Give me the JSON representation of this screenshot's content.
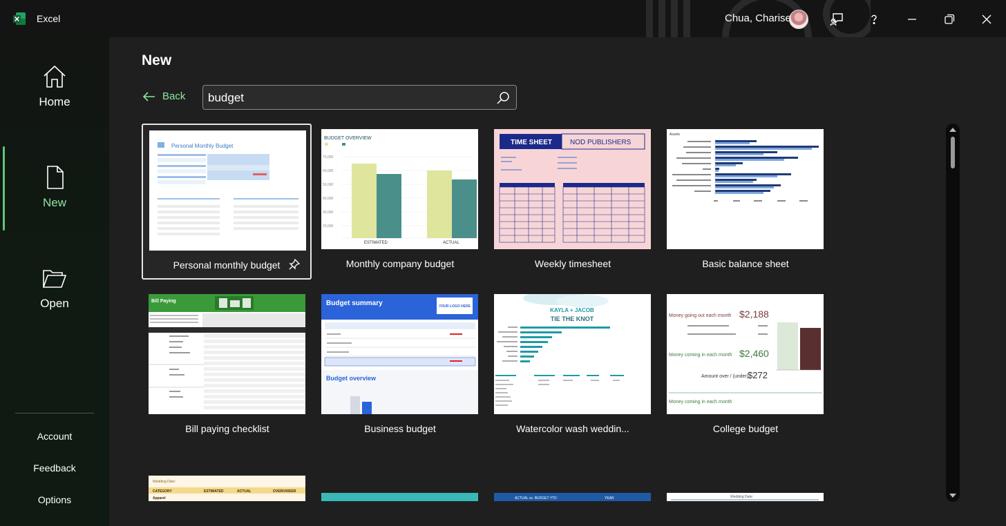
{
  "app": {
    "name": "Excel"
  },
  "user": {
    "name": "Chua, Charise"
  },
  "sidebar": {
    "nav": [
      {
        "label": "Home",
        "icon": "home-icon"
      },
      {
        "label": "New",
        "icon": "new-document-icon"
      },
      {
        "label": "Open",
        "icon": "folder-open-icon"
      }
    ],
    "links": [
      "Account",
      "Feedback",
      "Options"
    ]
  },
  "page": {
    "title": "New"
  },
  "back": {
    "label": "Back"
  },
  "search": {
    "value": "budget"
  },
  "templates": [
    {
      "caption": "Personal monthly budget"
    },
    {
      "caption": "Monthly company budget"
    },
    {
      "caption": "Weekly timesheet"
    },
    {
      "caption": "Basic balance sheet"
    },
    {
      "caption": "Bill paying checklist"
    },
    {
      "caption": "Business budget"
    },
    {
      "caption": "Watercolor wash weddin..."
    },
    {
      "caption": "College budget"
    }
  ],
  "thumb_text": {
    "pmb_title": "Personal Monthly Budget",
    "mcb_title": "BUDGET OVERVIEW",
    "mcb_estimated": "ESTIMATED",
    "mcb_actual": "ACTUAL",
    "ts_time_sheet": "TIME SHEET",
    "ts_publisher": "NOD PUBLISHERS",
    "bs_assets": "Assets",
    "bp_title": "Bill Paying",
    "bus_title": "Budget summary",
    "bus_logo": "YOUR LOGO HERE",
    "bus_overview": "Budget overview",
    "wed_names": "KAYLA + JACOB",
    "wed_tagline": "TIE THE KNOT",
    "col_out_label": "Money going out each month",
    "col_out_value": "$2,188",
    "col_in_label": "Money coming in each month",
    "col_in_value": "$2,460",
    "col_over_label": "Amount over / (under)",
    "col_over_value": "$272",
    "r3a_label": "Wedding Date:",
    "r3a_category": "CATEGORY",
    "r3a_estimated": "ESTIMATED",
    "r3a_actual": "ACTUAL",
    "r3a_over": "OVER/UNDER",
    "r3a_row": "Apparel",
    "r3c_header": "ACTUAL vs. BUDGET YTD",
    "r3c_year": "YEAR",
    "r3d_label": "Wedding Date:"
  },
  "colors": {
    "accent_green": "#8ee3a0",
    "excel_green": "#107c41",
    "navy": "#1b2a8a",
    "teal": "#1f9aa6"
  }
}
